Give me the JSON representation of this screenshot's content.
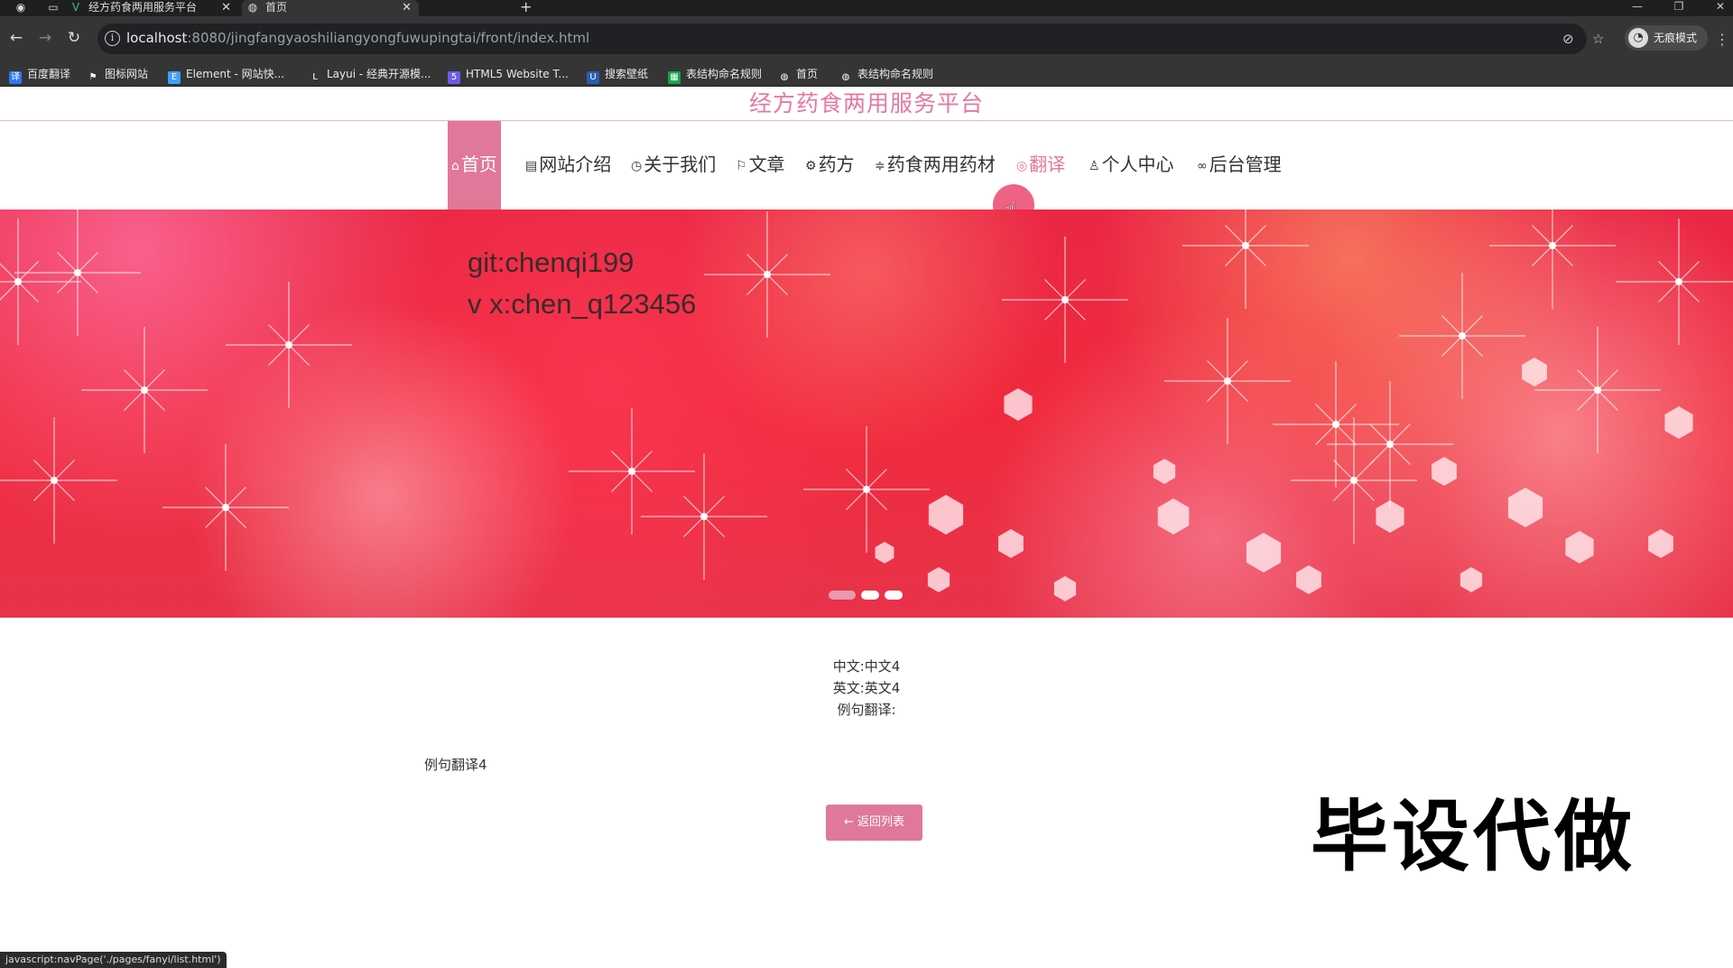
{
  "browser": {
    "tabs": [
      {
        "title": "经方药食两用服务平台",
        "active": false
      },
      {
        "title": "首页",
        "active": true
      }
    ],
    "new_tab_label": "+",
    "address": {
      "host": "localhost",
      "path": ":8080/jingfangyaoshiliangyongfuwupingtai/front/index.html"
    },
    "incognito_label": "无痕模式",
    "bookmarks": [
      {
        "label": "百度翻译",
        "icon": "baidu-translate-icon",
        "color": "#2b79f3"
      },
      {
        "label": "图标网站",
        "icon": "flag-icon",
        "color": "#353535"
      },
      {
        "label": "Element - 网站快...",
        "icon": "element-icon",
        "color": "#409eff"
      },
      {
        "label": "Layui - 经典开源模...",
        "icon": "layui-icon",
        "color": "#353535"
      },
      {
        "label": "HTML5 Website T...",
        "icon": "html5-template-icon",
        "color": "#6b5ce7"
      },
      {
        "label": "搜索壁纸",
        "icon": "wallpaper-icon",
        "color": "#2a5db0"
      },
      {
        "label": "表结构命名规则",
        "icon": "sheet-icon",
        "color": "#14a44d"
      },
      {
        "label": "首页",
        "icon": "globe-icon",
        "color": "#353535"
      },
      {
        "label": "表结构命名规则",
        "icon": "globe-icon",
        "color": "#353535"
      }
    ]
  },
  "site": {
    "title": "经方药食两用服务平台",
    "accent_color": "#e0789a"
  },
  "nav": [
    {
      "label": "首页",
      "icon": "home-icon",
      "glyph": "⌂",
      "state": "active"
    },
    {
      "label": "网站介绍",
      "icon": "news-icon",
      "glyph": "▤",
      "state": "normal"
    },
    {
      "label": "关于我们",
      "icon": "power-icon",
      "glyph": "◷",
      "state": "normal"
    },
    {
      "label": "文章",
      "icon": "flag-icon",
      "glyph": "⚐",
      "state": "normal"
    },
    {
      "label": "药方",
      "icon": "gear-icon",
      "glyph": "⚙",
      "state": "normal"
    },
    {
      "label": "药食两用药材",
      "icon": "sliders-icon",
      "glyph": "≑",
      "state": "normal"
    },
    {
      "label": "翻译",
      "icon": "translate-icon",
      "glyph": "◎",
      "state": "hover"
    },
    {
      "label": "个人中心",
      "icon": "user-icon",
      "glyph": "♙",
      "state": "normal"
    },
    {
      "label": "后台管理",
      "icon": "link-icon",
      "glyph": "∞",
      "state": "normal"
    }
  ],
  "banner": {
    "lines": [
      "git:chenqi199",
      "v x:chen_q123456"
    ],
    "carousel_count": 3,
    "carousel_active_index": 0
  },
  "detail": {
    "chinese": "中文:中文4",
    "english": "英文:英文4",
    "example_label": "例句翻译:",
    "example_value": "例句翻译4",
    "back_button": "返回列表"
  },
  "watermark": "毕设代做",
  "status_url": "javascript:navPage('./pages/fanyi/list.html')"
}
